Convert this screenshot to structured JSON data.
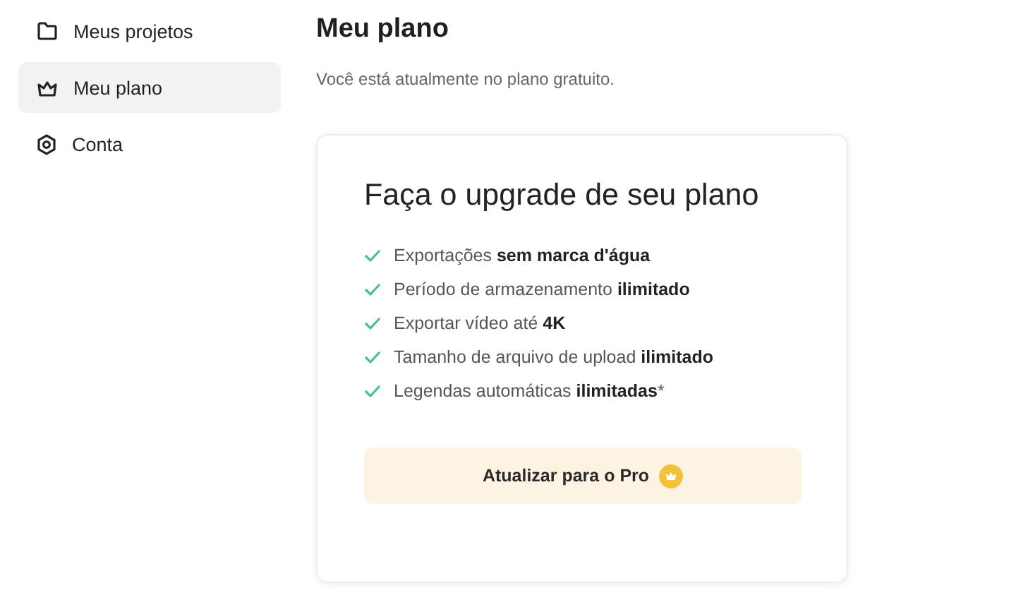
{
  "sidebar": {
    "items": [
      {
        "label": "Meus projetos",
        "kind": "folder",
        "selected": false
      },
      {
        "label": "Meu plano",
        "kind": "crown",
        "selected": true
      },
      {
        "label": "Conta",
        "kind": "settings",
        "selected": false
      }
    ]
  },
  "page": {
    "title": "Meu plano",
    "subtitle": "Você está atualmente no plano gratuito."
  },
  "card": {
    "heading": "Faça o upgrade de seu plano",
    "features": [
      "Exportações **sem marca d'água**",
      "Período de armazenamento **ilimitado**",
      "Exportar vídeo até **4K**",
      "Tamanho de arquivo de upload **ilimitado**",
      "Legendas automáticas **ilimitadas***"
    ],
    "button": "Atualizar para o Pro"
  }
}
